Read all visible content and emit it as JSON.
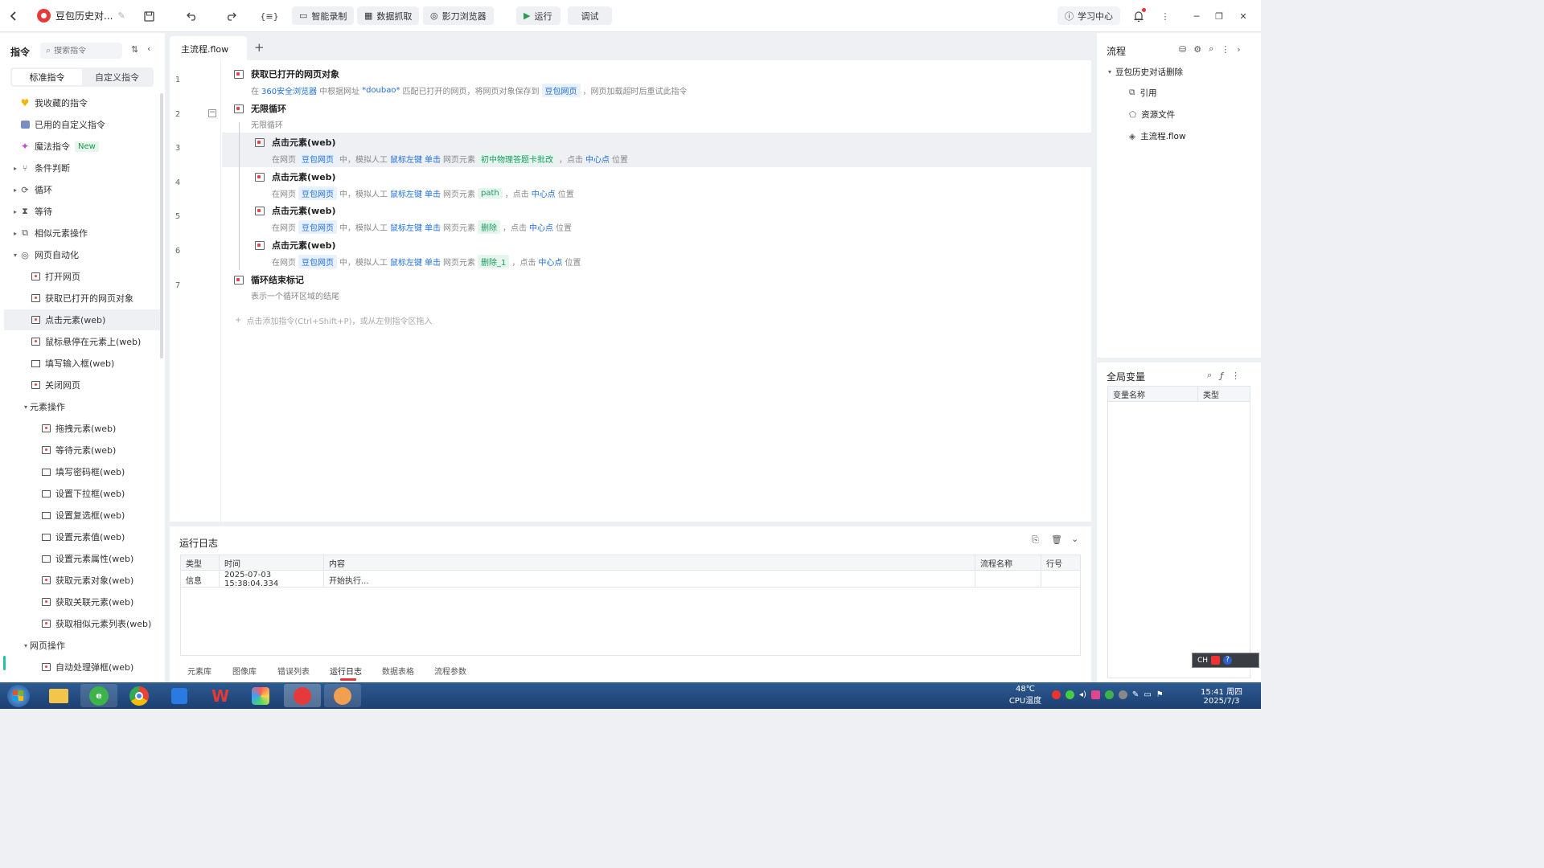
{
  "title": "豆包历史对...",
  "toolbar": {
    "smart_record": "智能录制",
    "data_grab": "数据抓取",
    "browser": "影刀浏览器",
    "run": "运行",
    "debug": "调试",
    "learn": "学习中心"
  },
  "left": {
    "title": "指令",
    "search_placeholder": "搜索指令",
    "tab_standard": "标准指令",
    "tab_custom": "自定义指令",
    "items": [
      {
        "label": "我收藏的指令",
        "level": 0,
        "icon": "heart-icon"
      },
      {
        "label": "已用的自定义指令",
        "level": 0,
        "icon": "custom-icon"
      },
      {
        "label": "魔法指令",
        "level": 0,
        "icon": "magic-icon",
        "badge": "New"
      },
      {
        "label": "条件判断",
        "level": 0,
        "icon": "branch-icon",
        "arrow": "▸"
      },
      {
        "label": "循环",
        "level": 0,
        "icon": "loop-icon",
        "arrow": "▸"
      },
      {
        "label": "等待",
        "level": 0,
        "icon": "hourglass-icon",
        "arrow": "▸"
      },
      {
        "label": "相似元素操作",
        "level": 0,
        "icon": "copy-icon",
        "arrow": "▸"
      },
      {
        "label": "网页自动化",
        "level": 0,
        "icon": "web-auto-icon",
        "arrow": "▾"
      },
      {
        "label": "打开网页",
        "level": 1,
        "icon": "web-page-icon"
      },
      {
        "label": "获取已打开的网页对象",
        "level": 1,
        "icon": "web-page-icon"
      },
      {
        "label": "点击元素(web)",
        "level": 1,
        "icon": "web-page-icon",
        "selected": true
      },
      {
        "label": "鼠标悬停在元素上(web)",
        "level": 1,
        "icon": "web-page-icon"
      },
      {
        "label": "填写输入框(web)",
        "level": 1,
        "icon": "input-icon"
      },
      {
        "label": "关闭网页",
        "level": 1,
        "icon": "web-page-icon"
      },
      {
        "label": "元素操作",
        "level": 1,
        "icon": "",
        "arrow": "▾"
      },
      {
        "label": "拖拽元素(web)",
        "level": 2,
        "icon": "web-page-icon"
      },
      {
        "label": "等待元素(web)",
        "level": 2,
        "icon": "web-page-icon"
      },
      {
        "label": "填写密码框(web)",
        "level": 2,
        "icon": "input-icon"
      },
      {
        "label": "设置下拉框(web)",
        "level": 2,
        "icon": "input-icon"
      },
      {
        "label": "设置复选框(web)",
        "level": 2,
        "icon": "input-icon"
      },
      {
        "label": "设置元素值(web)",
        "level": 2,
        "icon": "input-icon"
      },
      {
        "label": "设置元素属性(web)",
        "level": 2,
        "icon": "input-icon"
      },
      {
        "label": "获取元素对象(web)",
        "level": 2,
        "icon": "web-page-icon"
      },
      {
        "label": "获取关联元素(web)",
        "level": 2,
        "icon": "web-page-icon"
      },
      {
        "label": "获取相似元素列表(web)",
        "level": 2,
        "icon": "web-page-icon"
      },
      {
        "label": "网页操作",
        "level": 1,
        "icon": "",
        "arrow": "▾"
      },
      {
        "label": "自动处理弹框(web)",
        "level": 2,
        "icon": "web-page-icon"
      }
    ]
  },
  "editor": {
    "tab": "主流程.flow",
    "add_hint": "点击添加指令(Ctrl+Shift+P)，或从左侧指令区拖入",
    "rows": [
      {
        "num": "1",
        "title": "获取已打开的网页对象",
        "indent": 0,
        "desc": [
          {
            "t": "在"
          },
          {
            "t": "360安全浏览器",
            "c": "kw"
          },
          {
            "t": "中根据网址"
          },
          {
            "t": "*doubao*",
            "c": "kw"
          },
          {
            "t": "匹配已打开的网页，将网页对象保存到"
          },
          {
            "t": "豆包网页",
            "c": "chip"
          },
          {
            "t": "，网页加载超时后重试此指令"
          }
        ]
      },
      {
        "num": "2",
        "title": "无限循环",
        "indent": 0,
        "desc": [
          {
            "t": "无限循环"
          }
        ]
      },
      {
        "num": "3",
        "title": "点击元素(web)",
        "indent": 1,
        "selected": true,
        "desc": [
          {
            "t": "在网页"
          },
          {
            "t": "豆包网页",
            "c": "chip"
          },
          {
            "t": "中，模拟人工"
          },
          {
            "t": "鼠标左键",
            "c": "kw"
          },
          {
            "t": "单击",
            "c": "kw"
          },
          {
            "t": "网页元素"
          },
          {
            "t": "初中物理答题卡批改",
            "c": "chip-g"
          },
          {
            "t": "，点击"
          },
          {
            "t": "中心点",
            "c": "kw"
          },
          {
            "t": "位置"
          }
        ]
      },
      {
        "num": "4",
        "title": "点击元素(web)",
        "indent": 1,
        "desc": [
          {
            "t": "在网页"
          },
          {
            "t": "豆包网页",
            "c": "chip"
          },
          {
            "t": "中，模拟人工"
          },
          {
            "t": "鼠标左键",
            "c": "kw"
          },
          {
            "t": "单击",
            "c": "kw"
          },
          {
            "t": "网页元素"
          },
          {
            "t": "path",
            "c": "chip-g"
          },
          {
            "t": "，点击"
          },
          {
            "t": "中心点",
            "c": "kw"
          },
          {
            "t": "位置"
          }
        ]
      },
      {
        "num": "5",
        "title": "点击元素(web)",
        "indent": 1,
        "desc": [
          {
            "t": "在网页"
          },
          {
            "t": "豆包网页",
            "c": "chip"
          },
          {
            "t": "中，模拟人工"
          },
          {
            "t": "鼠标左键",
            "c": "kw"
          },
          {
            "t": "单击",
            "c": "kw"
          },
          {
            "t": "网页元素"
          },
          {
            "t": "删除",
            "c": "chip-g"
          },
          {
            "t": "，点击"
          },
          {
            "t": "中心点",
            "c": "kw"
          },
          {
            "t": "位置"
          }
        ]
      },
      {
        "num": "6",
        "title": "点击元素(web)",
        "indent": 1,
        "desc": [
          {
            "t": "在网页"
          },
          {
            "t": "豆包网页",
            "c": "chip"
          },
          {
            "t": "中，模拟人工"
          },
          {
            "t": "鼠标左键",
            "c": "kw"
          },
          {
            "t": "单击",
            "c": "kw"
          },
          {
            "t": "网页元素"
          },
          {
            "t": "删除_1",
            "c": "chip-g"
          },
          {
            "t": "，点击"
          },
          {
            "t": "中心点",
            "c": "kw"
          },
          {
            "t": "位置"
          }
        ]
      },
      {
        "num": "7",
        "title": "循环结束标记",
        "indent": 0,
        "desc": [
          {
            "t": "表示一个循环区域的结尾"
          }
        ]
      }
    ]
  },
  "log": {
    "title": "运行日志",
    "headers": [
      "类型",
      "时间",
      "内容",
      "流程名称",
      "行号"
    ],
    "rows": [
      [
        "信息",
        "2025-07-03 15:38:04.334",
        "开始执行...",
        "",
        ""
      ]
    ],
    "tabs": [
      "元素库",
      "图像库",
      "错误列表",
      "运行日志",
      "数据表格",
      "流程参数"
    ],
    "active_tab": "运行日志"
  },
  "right": {
    "flow_title": "流程",
    "project": "豆包历史对话删除",
    "children": [
      "引用",
      "资源文件",
      "主流程.flow"
    ],
    "vars_title": "全局变量",
    "var_headers": [
      "变量名称",
      "类型"
    ]
  },
  "ime": "CH",
  "taskbar": {
    "temp": "48℃",
    "temp_label": "CPU温度",
    "time": "15:41 周四",
    "date": "2025/7/3"
  },
  "colors": {
    "accent": "#1f6fd6",
    "green_chip": "#1a9a62",
    "taskbar": "#1c3f70"
  }
}
